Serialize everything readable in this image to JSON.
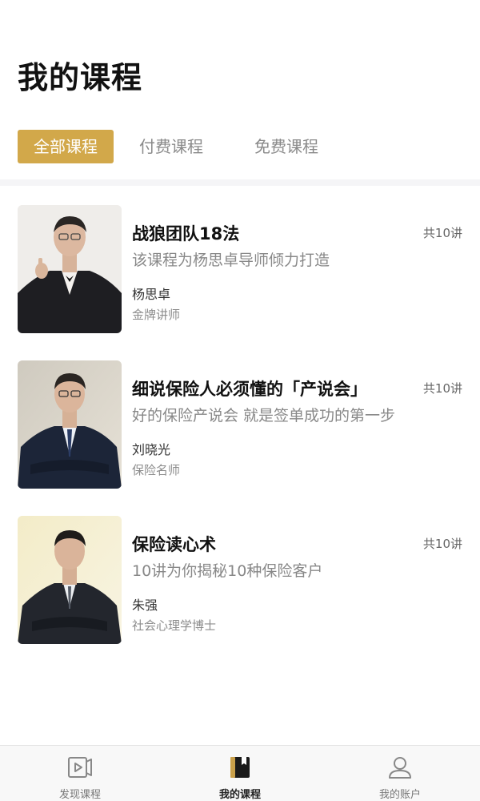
{
  "header": {
    "title": "我的课程"
  },
  "tabs": [
    {
      "label": "全部课程",
      "active": true
    },
    {
      "label": "付费课程",
      "active": false
    },
    {
      "label": "免费课程",
      "active": false
    }
  ],
  "courses": [
    {
      "title": "战狼团队18法",
      "lessons": "共10讲",
      "desc": "该课程为杨思卓导师倾力打造",
      "teacher": "杨思卓",
      "teacher_title": "金牌讲师"
    },
    {
      "title": "细说保险人必须懂的「产说会」",
      "lessons": "共10讲",
      "desc": "好的保险产说会 就是签单成功的第一步",
      "teacher": "刘晓光",
      "teacher_title": "保险名师"
    },
    {
      "title": "保险读心术",
      "lessons": "共10讲",
      "desc": "10讲为你揭秘10种保险客户",
      "teacher": "朱强",
      "teacher_title": "社会心理学博士"
    }
  ],
  "tabbar": [
    {
      "label": "发现课程",
      "icon": "video-play-icon",
      "active": false
    },
    {
      "label": "我的课程",
      "icon": "book-icon",
      "active": true
    },
    {
      "label": "我的账户",
      "icon": "user-icon",
      "active": false
    }
  ],
  "colors": {
    "accent": "#d2a84a",
    "muted": "#888888",
    "divider": "#f5f5f7"
  }
}
